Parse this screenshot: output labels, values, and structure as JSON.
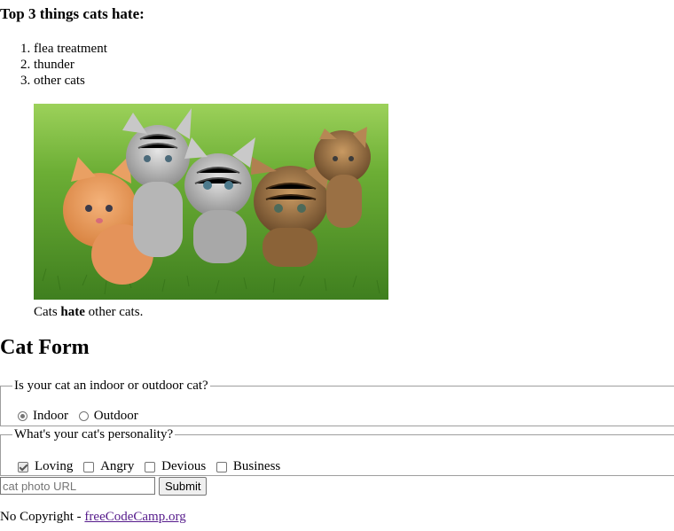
{
  "list_heading": {
    "text": "Top 3 things cats hate:"
  },
  "hate_list": [
    "flea treatment",
    "thunder",
    "other cats"
  ],
  "figure": {
    "image_alt": "Five kittens in the grass",
    "caption": {
      "before": "Cats ",
      "emphasis": "hate",
      "after": " other cats."
    }
  },
  "form_heading": "Cat Form",
  "location": {
    "legend": "Is your cat an indoor or outdoor cat?",
    "options": [
      {
        "label": "Indoor",
        "checked": true
      },
      {
        "label": "Outdoor",
        "checked": false
      }
    ]
  },
  "personality": {
    "legend": "What's your cat's personality?",
    "options": [
      {
        "label": "Loving",
        "checked": true
      },
      {
        "label": "Angry",
        "checked": false
      },
      {
        "label": "Devious",
        "checked": false
      },
      {
        "label": "Business",
        "checked": false
      }
    ]
  },
  "photo_url_field": {
    "placeholder": "cat photo URL",
    "value": ""
  },
  "submit_label": "Submit",
  "footer": {
    "text": "No Copyright - ",
    "link": "freeCodeCamp.org"
  },
  "colors": {
    "link_visited": "#551a8b",
    "grass": "#5a9e2f",
    "fieldset_border": "#9e9e9e"
  }
}
